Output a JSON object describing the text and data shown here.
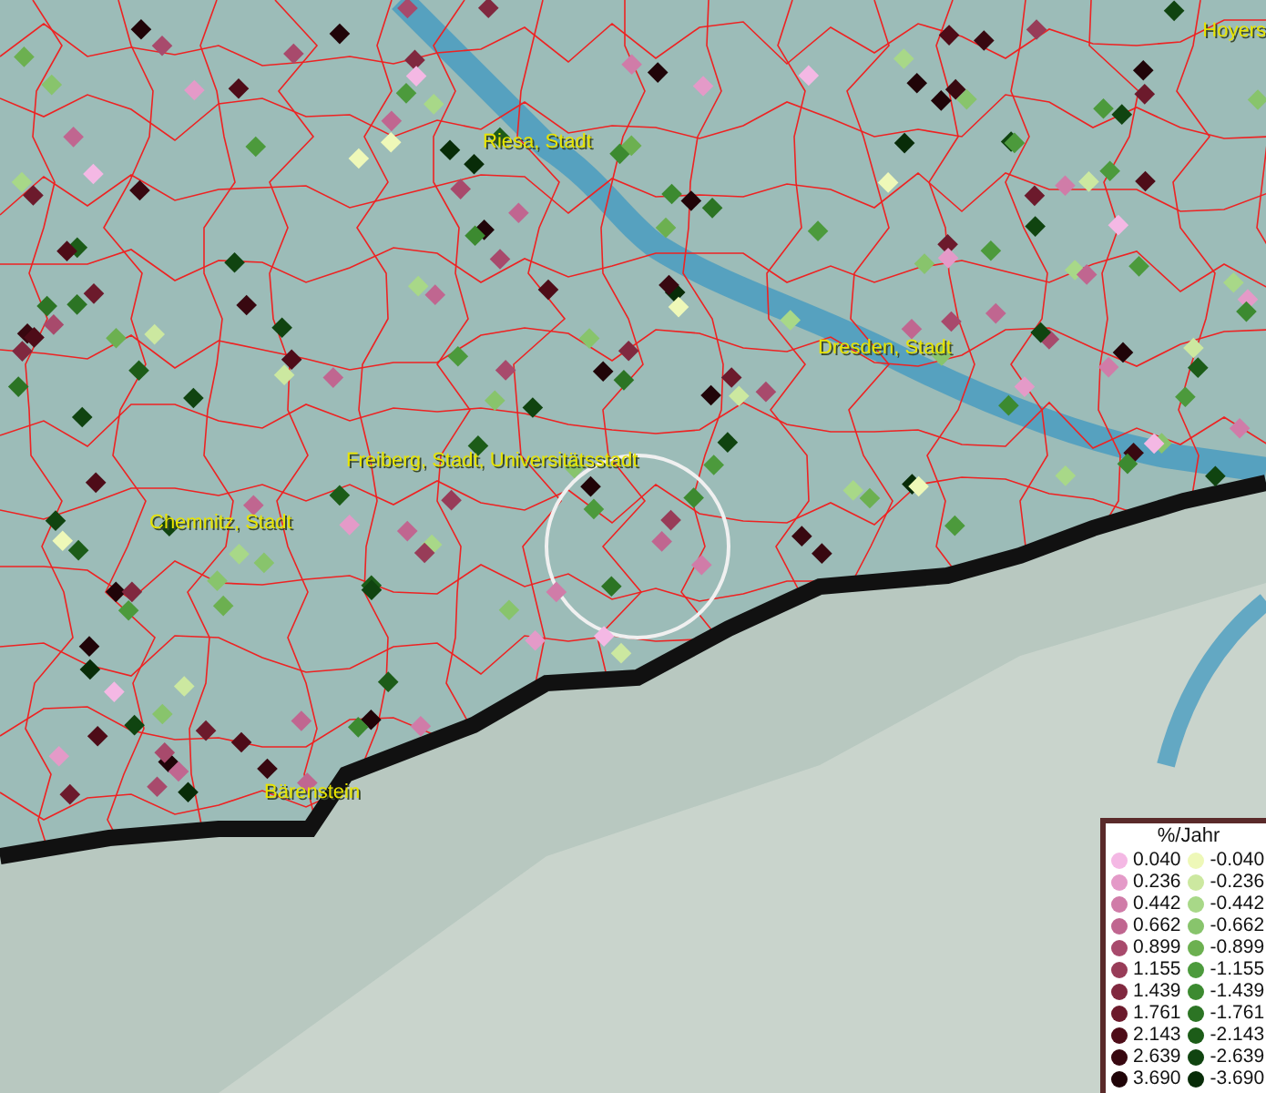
{
  "map": {
    "places": [
      {
        "name": "Hoyers"
      },
      {
        "name": "Riesa, Stadt"
      },
      {
        "name": "Dresden, Stadt"
      },
      {
        "name": "Freiberg, Stadt, Universitätsstadt"
      },
      {
        "name": "Chemnitz, Stadt"
      },
      {
        "name": "Bärenstein"
      }
    ]
  },
  "legend": {
    "title": "%/Jahr",
    "positive": [
      {
        "value": "0.040",
        "color": "#f4b8e4"
      },
      {
        "value": "0.236",
        "color": "#e49ac8"
      },
      {
        "value": "0.442",
        "color": "#d07ca8"
      },
      {
        "value": "0.662",
        "color": "#c06690"
      },
      {
        "value": "0.899",
        "color": "#a84a6c"
      },
      {
        "value": "1.155",
        "color": "#983c58"
      },
      {
        "value": "1.439",
        "color": "#80283f"
      },
      {
        "value": "1.761",
        "color": "#6c1a2c"
      },
      {
        "value": "2.143",
        "color": "#4e0c18"
      },
      {
        "value": "2.639",
        "color": "#380810"
      },
      {
        "value": "3.690",
        "color": "#200408"
      }
    ],
    "negative": [
      {
        "value": "-0.040",
        "color": "#eef8b8"
      },
      {
        "value": "-0.236",
        "color": "#cce8a0"
      },
      {
        "value": "-0.442",
        "color": "#a8d888"
      },
      {
        "value": "-0.662",
        "color": "#88c46c"
      },
      {
        "value": "-0.899",
        "color": "#6cb050"
      },
      {
        "value": "-1.155",
        "color": "#4c9a3c"
      },
      {
        "value": "-1.439",
        "color": "#3c8a30"
      },
      {
        "value": "-1.761",
        "color": "#2c7424"
      },
      {
        "value": "-2.143",
        "color": "#1c5c18"
      },
      {
        "value": "-2.639",
        "color": "#104410"
      },
      {
        "value": "-3.690",
        "color": "#082c08"
      }
    ]
  }
}
